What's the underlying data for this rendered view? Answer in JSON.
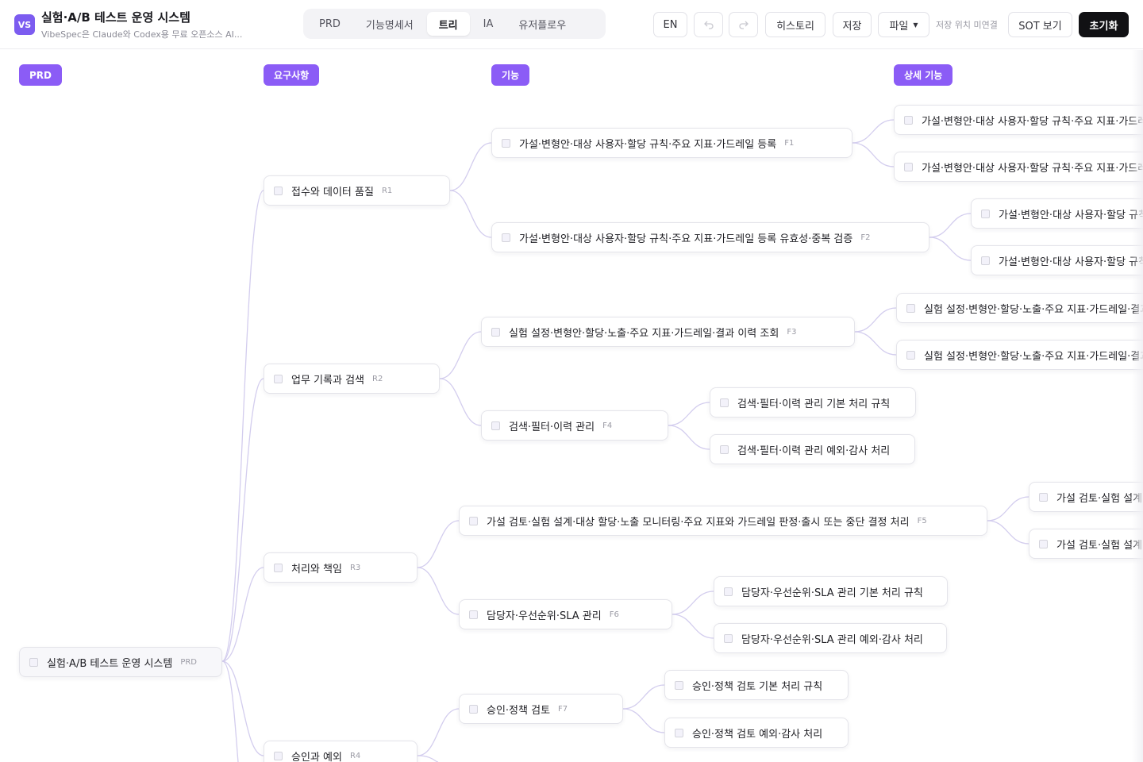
{
  "app": {
    "logo": "VS",
    "title": "실험·A/B 테스트 운영 시스템",
    "subtitle": "VibeSpec은 Claude와 Codex용 무료 오픈소스 AI..."
  },
  "tabs": [
    {
      "label": "PRD",
      "active": false
    },
    {
      "label": "기능명세서",
      "active": false
    },
    {
      "label": "트리",
      "active": true
    },
    {
      "label": "IA",
      "active": false
    },
    {
      "label": "유저플로우",
      "active": false
    }
  ],
  "toolbar": {
    "lang": "EN",
    "undo_icon": "undo-icon",
    "redo_icon": "redo-icon",
    "history": "히스토리",
    "save": "저장",
    "file": "파일",
    "file_icon": "caret-down-icon",
    "save_location": "저장 위치 미연결",
    "sot": "SOT 보기",
    "reset": "초기화"
  },
  "columns": [
    "PRD",
    "요구사항",
    "기능",
    "상세 기능"
  ],
  "colors": {
    "accent": "#8b5cf6",
    "link": "#cfc8ec"
  },
  "tree": {
    "root": {
      "label": "실험·A/B 테스트 운영 시스템",
      "code": "PRD"
    },
    "requirements": [
      {
        "label": "접수와 데이터 품질",
        "code": "R1"
      },
      {
        "label": "업무 기록과 검색",
        "code": "R2"
      },
      {
        "label": "처리와 책임",
        "code": "R3"
      },
      {
        "label": "승인과 예외",
        "code": "R4"
      }
    ],
    "features": [
      {
        "label": "가설·변형안·대상 사용자·할당 규칙·주요 지표·가드레일 등록",
        "code": "F1"
      },
      {
        "label": "가설·변형안·대상 사용자·할당 규칙·주요 지표·가드레일 등록 유효성·중복 검증",
        "code": "F2"
      },
      {
        "label": "실험 설정·변형안·할당·노출·주요 지표·가드레일·결과 이력 조회",
        "code": "F3"
      },
      {
        "label": "검색·필터·이력 관리",
        "code": "F4"
      },
      {
        "label": "가설 검토·실험 설계·대상 할당·노출 모니터링·주요 지표와 가드레일 판정·출시 또는 중단 결정 처리",
        "code": "F5"
      },
      {
        "label": "담당자·우선순위·SLA 관리",
        "code": "F6"
      },
      {
        "label": "승인·정책 검토",
        "code": "F7"
      }
    ],
    "details": [
      {
        "label": "가설·변형안·대상 사용자·할당 규칙·주요 지표·가드레"
      },
      {
        "label": "가설·변형안·대상 사용자·할당 규칙·주요 지표·가드레"
      },
      {
        "label": "가설·변형안·대상 사용자·할당 규칙"
      },
      {
        "label": "가설·변형안·대상 사용자·할당 규칙"
      },
      {
        "label": "실험 설정·변형안·할당·노출·주요 지표·가드레일·결과"
      },
      {
        "label": "실험 설정·변형안·할당·노출·주요 지표·가드레일·결과"
      },
      {
        "label": "검색·필터·이력 관리 기본 처리 규칙"
      },
      {
        "label": "검색·필터·이력 관리 예외·감사 처리"
      },
      {
        "label": "가설 검토·실험 설계"
      },
      {
        "label": "가설 검토·실험 설계"
      },
      {
        "label": "담당자·우선순위·SLA 관리 기본 처리 규칙"
      },
      {
        "label": "담당자·우선순위·SLA 관리 예외·감사 처리"
      },
      {
        "label": "승인·정책 검토 기본 처리 규칙"
      },
      {
        "label": "승인·정책 검토 예외·감사 처리"
      }
    ]
  }
}
